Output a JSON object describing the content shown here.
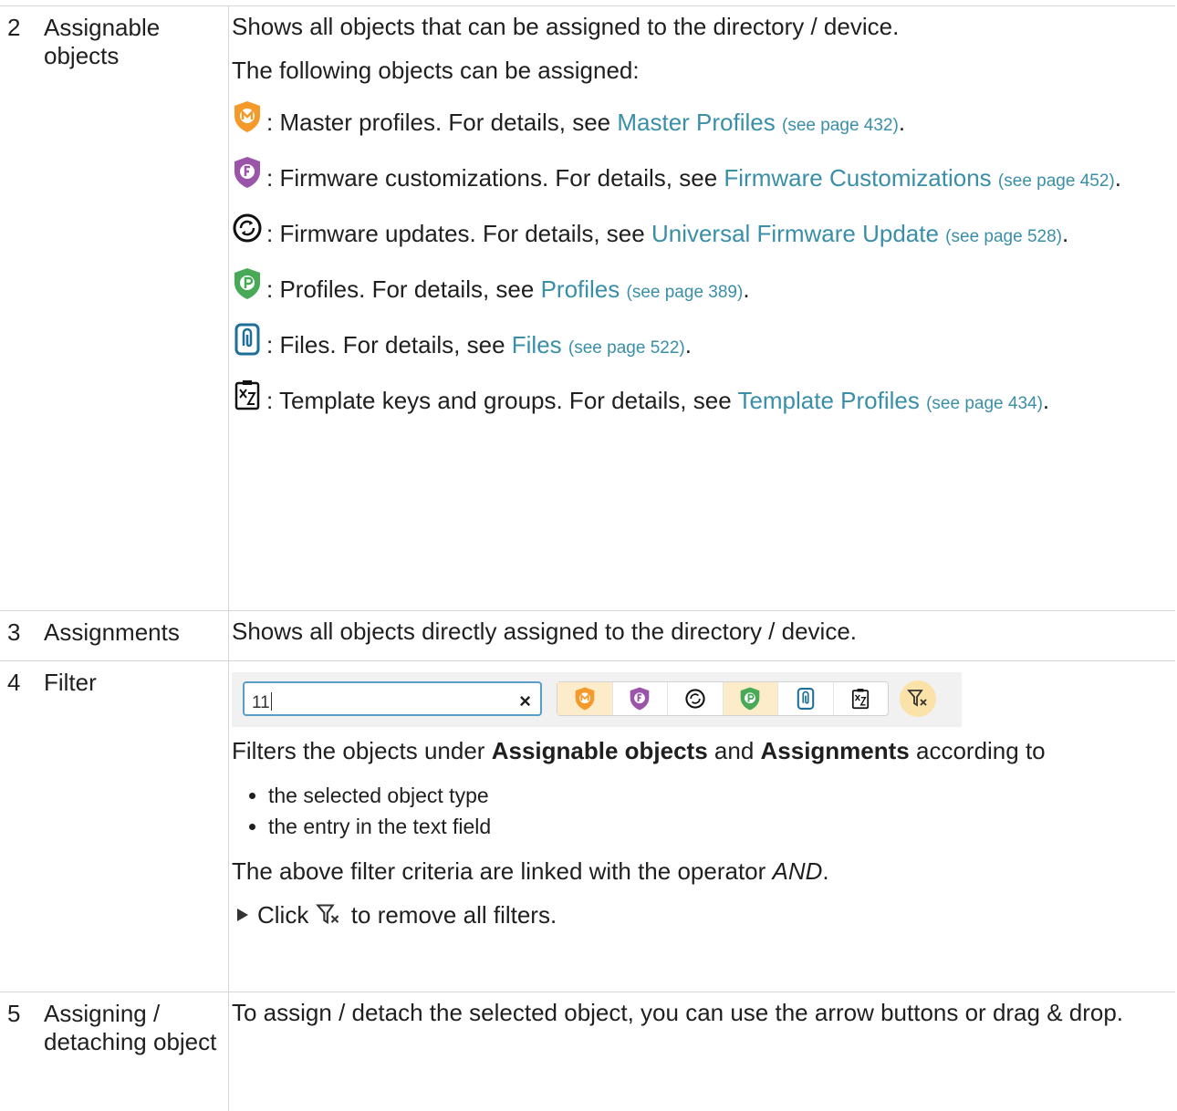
{
  "rows": [
    {
      "num": "2",
      "label": "Assignable objects",
      "intro": "Shows all objects that can be assigned to the directory / device.",
      "intro2": "The following objects can be assigned:",
      "items": [
        {
          "icon": "master-profile-icon",
          "text": ": Master profiles. For details, see ",
          "link": "Master Profiles",
          "ref": "(see page 432)"
        },
        {
          "icon": "firmware-customization-icon",
          "text": ": Firmware customizations. For details, see ",
          "link": "Firmware Customizations",
          "ref": "(see page 452)"
        },
        {
          "icon": "firmware-update-icon",
          "text": ": Firmware updates. For details, see ",
          "link": "Universal Firmware Update",
          "ref": "(see page 528)"
        },
        {
          "icon": "profile-icon",
          "text": ": Profiles. For details, see ",
          "link": "Profiles",
          "ref": "(see page 389)"
        },
        {
          "icon": "file-icon",
          "text": ": Files. For details, see ",
          "link": "Files",
          "ref": "(see page 522)"
        },
        {
          "icon": "template-icon",
          "text": ": Template keys and groups. For details, see ",
          "link": "Template Profiles",
          "ref": "(see page 434)"
        }
      ]
    },
    {
      "num": "3",
      "label": "Assignments",
      "desc": "Shows all objects directly assigned to the directory / device."
    },
    {
      "num": "4",
      "label": "Filter",
      "search_value": "11",
      "clear_symbol": "×",
      "filters_pre": "Filters the objects under ",
      "bold1": "Assignable objects",
      "filters_mid": " and ",
      "bold2": "Assignments",
      "filters_post": " according to",
      "bullets": [
        "the selected object type",
        "the entry in the text field"
      ],
      "operator_pre": "The above filter criteria are linked with the operator ",
      "operator": "AND",
      "operator_post": ".",
      "step_pre": "Click ",
      "step_post": " to remove all filters."
    },
    {
      "num": "5",
      "label": "Assigning / detaching object",
      "desc": "To assign / detach the selected object, you can use the arrow buttons or drag & drop."
    }
  ],
  "colors": {
    "link": "#3a8fa8",
    "master": "#f39a2b",
    "firmware_custom": "#9b55a8",
    "profile": "#48a957",
    "file": "#1d6f9a",
    "filter_active": "#fbe2a8"
  }
}
